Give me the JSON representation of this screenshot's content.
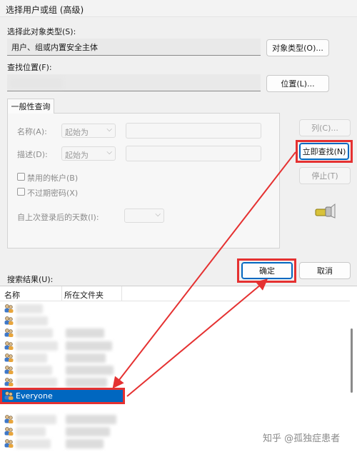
{
  "window": {
    "title": "选择用户或组 (高级)"
  },
  "object_type": {
    "label": "选择此对象类型(S):",
    "value": "用户、组或内置安全主体",
    "button": "对象类型(O)..."
  },
  "location": {
    "label": "查找位置(F):",
    "value": "",
    "button": "位置(L)..."
  },
  "query": {
    "tab": "一般性查询",
    "name_label": "名称(A):",
    "name_mode": "起始为",
    "desc_label": "描述(D):",
    "desc_mode": "起始为",
    "disabled_accounts": "禁用的帐户(B)",
    "non_expiring_pw": "不过期密码(X)",
    "days_since_login": "自上次登录后的天数(I):"
  },
  "side_buttons": {
    "columns": "列(C)...",
    "find_now": "立即查找(N)",
    "stop": "停止(T)"
  },
  "dialog_buttons": {
    "ok": "确定",
    "cancel": "取消"
  },
  "results": {
    "label": "搜索结果(U):",
    "columns": [
      "名称",
      "所在文件夹"
    ],
    "selected_row": "Everyone"
  },
  "watermark": "知乎 @孤独症患者",
  "colors": {
    "highlight": "#e53131",
    "selection": "#0067c0"
  }
}
